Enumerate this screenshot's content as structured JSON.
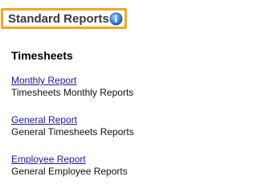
{
  "header": {
    "title": "Standard Reports",
    "info_icon": "info-icon",
    "border_color": "#f5a623"
  },
  "section": {
    "title": "Timesheets"
  },
  "reports": [
    {
      "link": "Monthly Report",
      "description": "Timesheets Monthly Reports"
    },
    {
      "link": "General Report",
      "description": "General Timesheets Reports"
    },
    {
      "link": "Employee Report",
      "description": "General Employee Reports"
    }
  ],
  "colors": {
    "link": "#1a1aa6",
    "text": "#111111"
  }
}
